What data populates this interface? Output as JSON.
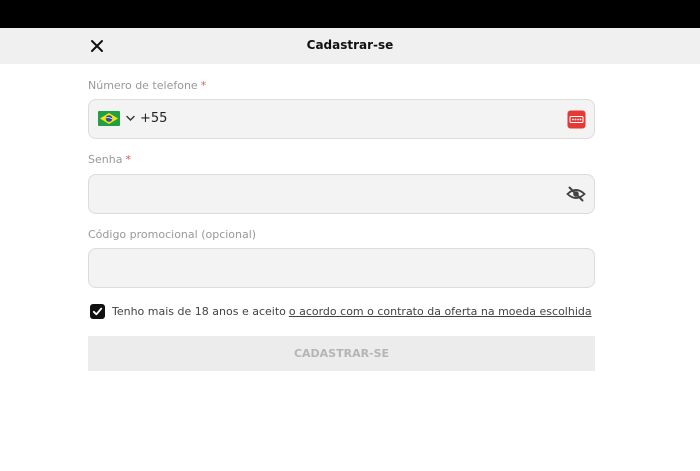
{
  "header": {
    "title": "Cadastrar-se",
    "close_icon": "close-icon"
  },
  "phone": {
    "label": "Número de telefone",
    "required_mark": "*",
    "country_flag": "brazil-flag-icon",
    "dial_code": "+55",
    "password_manager_icon": "password-manager-icon"
  },
  "password": {
    "label": "Senha",
    "required_mark": "*",
    "value": "",
    "visibility_icon": "eye-off-icon"
  },
  "promo": {
    "label": "Código promocional (opcional)",
    "value": ""
  },
  "terms": {
    "checked": true,
    "text": "Tenho mais de 18 anos e aceito",
    "link_text": "o acordo com o contrato da oferta na moeda escolhida"
  },
  "submit": {
    "label": "CADASTRAR-SE"
  },
  "colors": {
    "header_bg": "#f0f0f0",
    "field_bg": "#f3f3f3",
    "required": "#e05a5a",
    "password_manager_red": "#e53935",
    "button_disabled_bg": "#ececec",
    "button_disabled_text": "#b5b5b5"
  }
}
